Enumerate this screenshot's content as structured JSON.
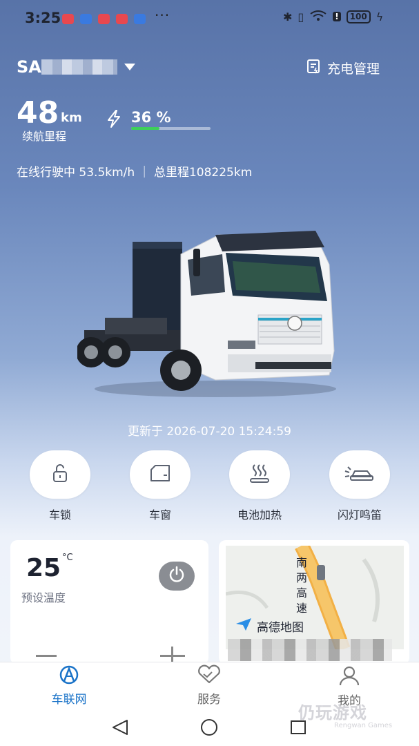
{
  "status_bar": {
    "time": "3:25",
    "dots": "···",
    "battery": "100"
  },
  "header": {
    "vehicle_id_prefix": "SA",
    "charge_management": "充电管理"
  },
  "range": {
    "value": "48",
    "unit": "km",
    "label": "续航里程"
  },
  "battery": {
    "percent_text": "36 %",
    "percent": 36,
    "bar_color": "#3ed05a"
  },
  "drive": {
    "status_text": "在线行驶中 53.5km/h ｜ 总里程108225km"
  },
  "update": {
    "text": "更新于 2026-07-20 15:24:59"
  },
  "controls": [
    {
      "label": "车锁",
      "icon": "lock-icon"
    },
    {
      "label": "车窗",
      "icon": "window-icon"
    },
    {
      "label": "电池加热",
      "icon": "heating-icon"
    },
    {
      "label": "闪灯鸣笛",
      "icon": "horn-icon"
    }
  ],
  "climate": {
    "temperature": "25",
    "unit": "°C",
    "label": "预设温度"
  },
  "map": {
    "road_label_lines": [
      "南",
      "两",
      "高",
      "速"
    ],
    "provider": "高德地图"
  },
  "nav": [
    {
      "label": "车联网",
      "active": true,
      "icon": "car-network-icon"
    },
    {
      "label": "服务",
      "active": false,
      "icon": "service-icon"
    },
    {
      "label": "我的",
      "active": false,
      "icon": "profile-icon"
    }
  ],
  "colors": {
    "nav_active": "#1a73c8",
    "nav_inactive": "#666666",
    "accent": "#3ed05a"
  },
  "watermark": {
    "main": "仍玩游戏",
    "sub": "Rengwan Games"
  }
}
